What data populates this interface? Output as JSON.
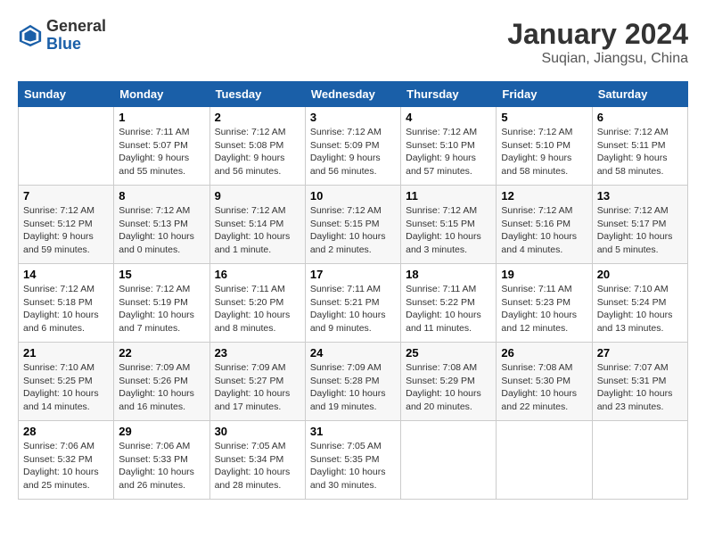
{
  "header": {
    "logo_general": "General",
    "logo_blue": "Blue",
    "month_title": "January 2024",
    "subtitle": "Suqian, Jiangsu, China"
  },
  "days_of_week": [
    "Sunday",
    "Monday",
    "Tuesday",
    "Wednesday",
    "Thursday",
    "Friday",
    "Saturday"
  ],
  "weeks": [
    [
      {
        "day": "",
        "info": ""
      },
      {
        "day": "1",
        "info": "Sunrise: 7:11 AM\nSunset: 5:07 PM\nDaylight: 9 hours\nand 55 minutes."
      },
      {
        "day": "2",
        "info": "Sunrise: 7:12 AM\nSunset: 5:08 PM\nDaylight: 9 hours\nand 56 minutes."
      },
      {
        "day": "3",
        "info": "Sunrise: 7:12 AM\nSunset: 5:09 PM\nDaylight: 9 hours\nand 56 minutes."
      },
      {
        "day": "4",
        "info": "Sunrise: 7:12 AM\nSunset: 5:10 PM\nDaylight: 9 hours\nand 57 minutes."
      },
      {
        "day": "5",
        "info": "Sunrise: 7:12 AM\nSunset: 5:10 PM\nDaylight: 9 hours\nand 58 minutes."
      },
      {
        "day": "6",
        "info": "Sunrise: 7:12 AM\nSunset: 5:11 PM\nDaylight: 9 hours\nand 58 minutes."
      }
    ],
    [
      {
        "day": "7",
        "info": "Sunrise: 7:12 AM\nSunset: 5:12 PM\nDaylight: 9 hours\nand 59 minutes."
      },
      {
        "day": "8",
        "info": "Sunrise: 7:12 AM\nSunset: 5:13 PM\nDaylight: 10 hours\nand 0 minutes."
      },
      {
        "day": "9",
        "info": "Sunrise: 7:12 AM\nSunset: 5:14 PM\nDaylight: 10 hours\nand 1 minute."
      },
      {
        "day": "10",
        "info": "Sunrise: 7:12 AM\nSunset: 5:15 PM\nDaylight: 10 hours\nand 2 minutes."
      },
      {
        "day": "11",
        "info": "Sunrise: 7:12 AM\nSunset: 5:15 PM\nDaylight: 10 hours\nand 3 minutes."
      },
      {
        "day": "12",
        "info": "Sunrise: 7:12 AM\nSunset: 5:16 PM\nDaylight: 10 hours\nand 4 minutes."
      },
      {
        "day": "13",
        "info": "Sunrise: 7:12 AM\nSunset: 5:17 PM\nDaylight: 10 hours\nand 5 minutes."
      }
    ],
    [
      {
        "day": "14",
        "info": "Sunrise: 7:12 AM\nSunset: 5:18 PM\nDaylight: 10 hours\nand 6 minutes."
      },
      {
        "day": "15",
        "info": "Sunrise: 7:12 AM\nSunset: 5:19 PM\nDaylight: 10 hours\nand 7 minutes."
      },
      {
        "day": "16",
        "info": "Sunrise: 7:11 AM\nSunset: 5:20 PM\nDaylight: 10 hours\nand 8 minutes."
      },
      {
        "day": "17",
        "info": "Sunrise: 7:11 AM\nSunset: 5:21 PM\nDaylight: 10 hours\nand 9 minutes."
      },
      {
        "day": "18",
        "info": "Sunrise: 7:11 AM\nSunset: 5:22 PM\nDaylight: 10 hours\nand 11 minutes."
      },
      {
        "day": "19",
        "info": "Sunrise: 7:11 AM\nSunset: 5:23 PM\nDaylight: 10 hours\nand 12 minutes."
      },
      {
        "day": "20",
        "info": "Sunrise: 7:10 AM\nSunset: 5:24 PM\nDaylight: 10 hours\nand 13 minutes."
      }
    ],
    [
      {
        "day": "21",
        "info": "Sunrise: 7:10 AM\nSunset: 5:25 PM\nDaylight: 10 hours\nand 14 minutes."
      },
      {
        "day": "22",
        "info": "Sunrise: 7:09 AM\nSunset: 5:26 PM\nDaylight: 10 hours\nand 16 minutes."
      },
      {
        "day": "23",
        "info": "Sunrise: 7:09 AM\nSunset: 5:27 PM\nDaylight: 10 hours\nand 17 minutes."
      },
      {
        "day": "24",
        "info": "Sunrise: 7:09 AM\nSunset: 5:28 PM\nDaylight: 10 hours\nand 19 minutes."
      },
      {
        "day": "25",
        "info": "Sunrise: 7:08 AM\nSunset: 5:29 PM\nDaylight: 10 hours\nand 20 minutes."
      },
      {
        "day": "26",
        "info": "Sunrise: 7:08 AM\nSunset: 5:30 PM\nDaylight: 10 hours\nand 22 minutes."
      },
      {
        "day": "27",
        "info": "Sunrise: 7:07 AM\nSunset: 5:31 PM\nDaylight: 10 hours\nand 23 minutes."
      }
    ],
    [
      {
        "day": "28",
        "info": "Sunrise: 7:06 AM\nSunset: 5:32 PM\nDaylight: 10 hours\nand 25 minutes."
      },
      {
        "day": "29",
        "info": "Sunrise: 7:06 AM\nSunset: 5:33 PM\nDaylight: 10 hours\nand 26 minutes."
      },
      {
        "day": "30",
        "info": "Sunrise: 7:05 AM\nSunset: 5:34 PM\nDaylight: 10 hours\nand 28 minutes."
      },
      {
        "day": "31",
        "info": "Sunrise: 7:05 AM\nSunset: 5:35 PM\nDaylight: 10 hours\nand 30 minutes."
      },
      {
        "day": "",
        "info": ""
      },
      {
        "day": "",
        "info": ""
      },
      {
        "day": "",
        "info": ""
      }
    ]
  ]
}
